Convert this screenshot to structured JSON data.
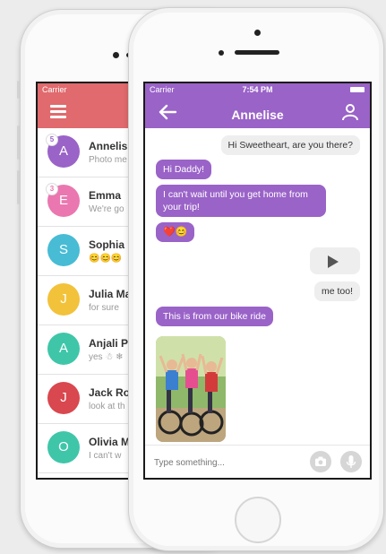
{
  "back_phone": {
    "status": {
      "carrier": "Carrier"
    },
    "header_color": "#e06a6d",
    "contacts": [
      {
        "initial": "A",
        "name": "Annelis",
        "preview": "Photo me",
        "color": "#9a63c8",
        "badge": "5"
      },
      {
        "initial": "E",
        "name": "Emma",
        "preview": "We're go",
        "color": "#ea77b0",
        "badge": "3"
      },
      {
        "initial": "S",
        "name": "Sophia",
        "preview": "😊😊😊",
        "color": "#47bcd4",
        "badge": ""
      },
      {
        "initial": "J",
        "name": "Julia Ma",
        "preview": "for sure",
        "color": "#f2c23a",
        "badge": ""
      },
      {
        "initial": "A",
        "name": "Anjali P",
        "preview": "yes ☃ ❄",
        "color": "#3fc6a9",
        "badge": ""
      },
      {
        "initial": "J",
        "name": "Jack Ro",
        "preview": "look at th",
        "color": "#d9474f",
        "badge": ""
      },
      {
        "initial": "O",
        "name": "Olivia M",
        "preview": "I can't w",
        "color": "#3fc6a9",
        "badge": ""
      }
    ]
  },
  "front_phone": {
    "status": {
      "carrier": "Carrier",
      "time": "7:54 PM"
    },
    "header": {
      "title": "Annelise",
      "color": "#9a63c8"
    },
    "messages": [
      {
        "direction": "out",
        "text": "Hi Sweetheart, are you there?"
      },
      {
        "direction": "in",
        "text": "Hi Daddy!"
      },
      {
        "direction": "in",
        "text": "I can't wait until you get home from your trip!"
      },
      {
        "direction": "in",
        "text": "❤️😊"
      },
      {
        "direction": "out",
        "type": "audio"
      },
      {
        "direction": "out",
        "text": "me too!"
      },
      {
        "direction": "in",
        "text": "This is from our bike ride"
      },
      {
        "direction": "in",
        "type": "photo"
      }
    ],
    "input": {
      "placeholder": "Type something..."
    }
  }
}
